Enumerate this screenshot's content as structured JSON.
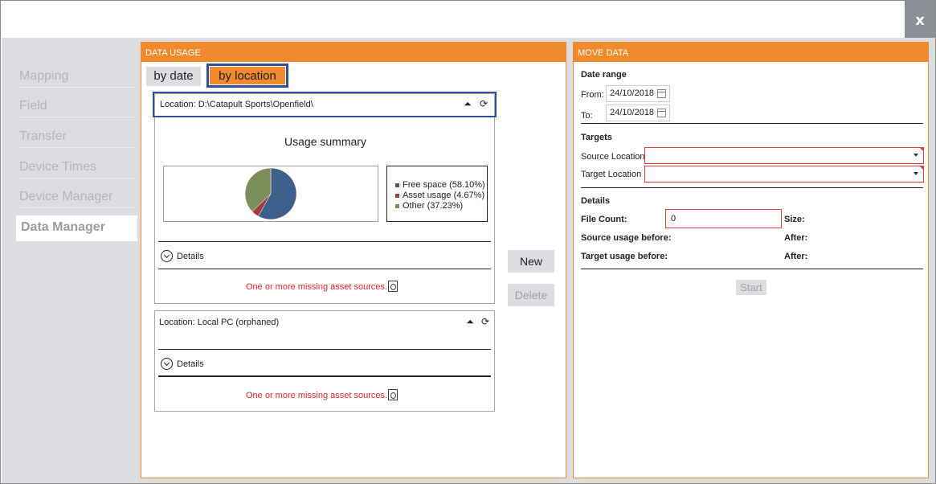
{
  "window": {
    "close_label": "x"
  },
  "sidebar": {
    "items": [
      {
        "label": "Mapping"
      },
      {
        "label": "Field"
      },
      {
        "label": "Transfer"
      },
      {
        "label": "Device Times"
      },
      {
        "label": "Device Manager"
      },
      {
        "label": "Data Manager",
        "active": true
      }
    ]
  },
  "data_usage": {
    "title": "DATA USAGE",
    "tabs": [
      {
        "label": "by date",
        "active": false
      },
      {
        "label": "by location",
        "active": true
      }
    ],
    "locations": [
      {
        "location": "Location: D:\\Catapult Sports\\Openfield\\",
        "summary_title": "Usage summary",
        "legend": [
          {
            "label": "Free space (58.10%)",
            "color": "#3d5f8c"
          },
          {
            "label": "Asset usage (4.67%)",
            "color": "#a23b3b"
          },
          {
            "label": "Other (37.23%)",
            "color": "#7b8f5a"
          }
        ],
        "details_label": "Details",
        "warning": "One or more missing asset sources."
      },
      {
        "location": "Location: Local PC (orphaned)",
        "details_label": "Details",
        "warning": "One or more missing asset sources."
      }
    ],
    "buttons": {
      "new": "New",
      "delete": "Delete"
    }
  },
  "chart_data": {
    "type": "pie",
    "title": "Usage summary",
    "categories": [
      "Free space",
      "Asset usage",
      "Other"
    ],
    "values": [
      58.1,
      4.67,
      37.23
    ],
    "colors": [
      "#3d5f8c",
      "#a23b3b",
      "#7b8f5a"
    ],
    "legend": "right"
  },
  "move_data": {
    "title": "MOVE DATA",
    "date_range_heading": "Date range",
    "from_label": "From:",
    "from_value": "24/10/2018",
    "to_label": "To:",
    "to_value": "24/10/2018",
    "targets_heading": "Targets",
    "source_location_label": "Source Location",
    "source_location_value": "",
    "target_location_label": "Target Location",
    "target_location_value": "",
    "details_heading": "Details",
    "file_count_label": "File Count:",
    "file_count_value": "0",
    "size_label": "Size:",
    "source_usage_label": "Source usage before:",
    "source_after_label": "After:",
    "target_usage_label": "Target usage before:",
    "target_after_label": "After:",
    "start_label": "Start"
  }
}
